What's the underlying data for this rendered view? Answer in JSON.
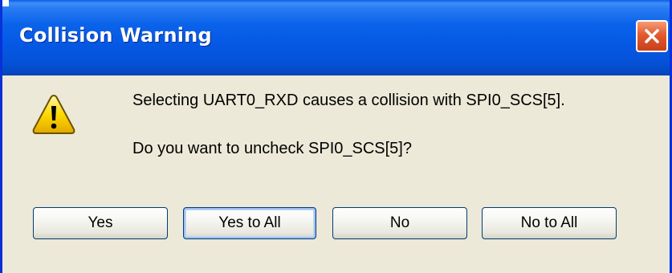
{
  "window": {
    "title": "Collision Warning",
    "close_icon": "close-x-icon",
    "accent_color": "#0558e4",
    "close_color": "#e45a2e"
  },
  "message": {
    "icon": "warning-triangle-icon",
    "line1": "Selecting UART0_RXD causes a collision with SPI0_SCS[5].",
    "line2": "Do you want to uncheck SPI0_SCS[5]?"
  },
  "buttons": {
    "yes": "Yes",
    "yes_to_all": "Yes to All",
    "no": "No",
    "no_to_all": "No to All"
  }
}
